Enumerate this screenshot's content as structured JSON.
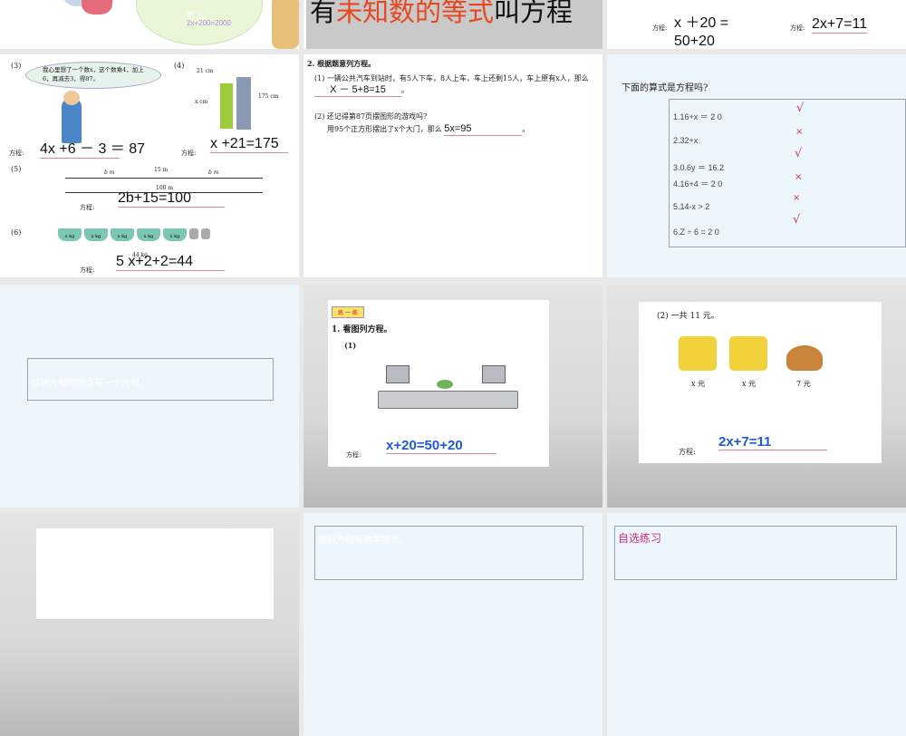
{
  "slides": {
    "s0": {
      "formula": "2x+200=2000",
      "text": "那么"
    },
    "s1": {
      "title_pre": "有",
      "title_red": "未知数的等式",
      "title_post": "叫方程"
    },
    "s2": {
      "label": "方程:",
      "eq1": "x ＋20 = 50+20",
      "eq2": "2x+7=11"
    },
    "s4": {
      "q3": "(3)",
      "bubble": "我心里想了一个数x，这个数乘4，加上6，再减去3，得87。",
      "q4": "(4)",
      "h1": "21 cm",
      "h2": "x cm",
      "h3": "175 cm",
      "label": "方程:",
      "a3": "4x +6 － 3 ＝ 87",
      "a4": "x +21=175",
      "q5": "(5)",
      "b1": "b m",
      "b2": "15 m",
      "b3": "b m",
      "b4": "100 m",
      "a5": "2b+15=100",
      "q6": "(6)",
      "bucket": "x kg",
      "total": "44 kg",
      "a6": "5 x+2+2=44"
    },
    "s5": {
      "heading": "2. 根据题意列方程。",
      "p1": "(1) 一辆公共汽车到站时，有5人下车，8人上车，车上还剩15人，车上原有x人，那么",
      "a1": "X － 5+8=15",
      "p2a": "(2) 还记得第87页摆图形的游戏吗?",
      "p2b": "用95个正方形摆出了x个大门，那么",
      "a2": "5x=95",
      "end": "。"
    },
    "s6": {
      "question": "下面的算式是方程吗?",
      "items": [
        {
          "text": "1.16+x ＝ 2 0",
          "mark": "√"
        },
        {
          "text": "2.32+x",
          "mark": "×"
        },
        {
          "text": "3.0.6y ＝ 16.2",
          "mark": "√"
        },
        {
          "text": "4.16+4 ＝ 2 0",
          "mark": "×"
        },
        {
          "text": "5.14-x > 2",
          "mark": "×"
        },
        {
          "text": "6.Z ÷ 6 = 2 0",
          "mark": "√"
        }
      ]
    },
    "s7": {
      "text": "根据方程的特点写一个方程。"
    },
    "s8": {
      "badge": "练 一 练",
      "heading": "1. 看图列方程。",
      "sub": "(1)",
      "label": "方程:",
      "answer": "x+20=50+20"
    },
    "s9": {
      "heading": "(2) 一共 11 元。",
      "p1": "x 元",
      "p2": "x 元",
      "p3": "7 元",
      "label": "方程:",
      "answer": "2x+7=11"
    },
    "s11": {
      "text": "根据方程编数学情景。"
    },
    "s12": {
      "text": "自选练习"
    }
  },
  "colors": {
    "red": "#e8461e",
    "mark": "#d02a7a",
    "answer_blue": "#1e5bd8"
  }
}
